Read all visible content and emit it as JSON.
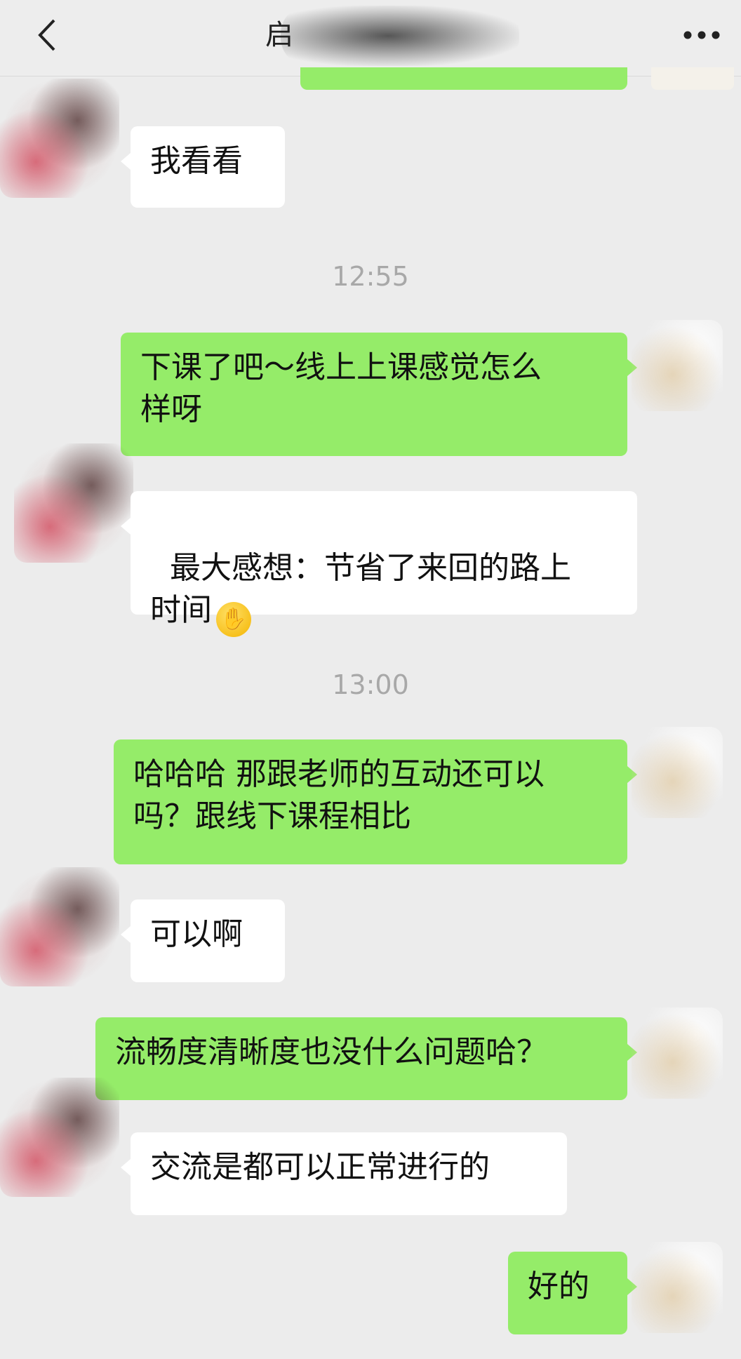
{
  "header": {
    "back_icon": "chevron-left-icon",
    "title": "启",
    "more_icon": "more-dots-icon"
  },
  "messages": [
    {
      "text": "我看看"
    },
    {
      "time": "12:55"
    },
    {
      "text": "下课了吧～线上上课感觉怎么\n样呀"
    },
    {
      "text": "最大感想：节省了来回的路上\n时间",
      "emoji": "face-palm-emoji"
    },
    {
      "time": "13:00"
    },
    {
      "text": "哈哈哈 那跟老师的互动还可以\n吗？跟线下课程相比"
    },
    {
      "text": "可以啊"
    },
    {
      "text": "流畅度清晰度也没什么问题哈？"
    },
    {
      "text": "交流是都可以正常进行的"
    },
    {
      "text": "好的"
    }
  ],
  "colors": {
    "background": "#ececec",
    "outgoing_bubble": "#95ec69",
    "incoming_bubble": "#ffffff",
    "timestamp": "#a8a8a8"
  }
}
